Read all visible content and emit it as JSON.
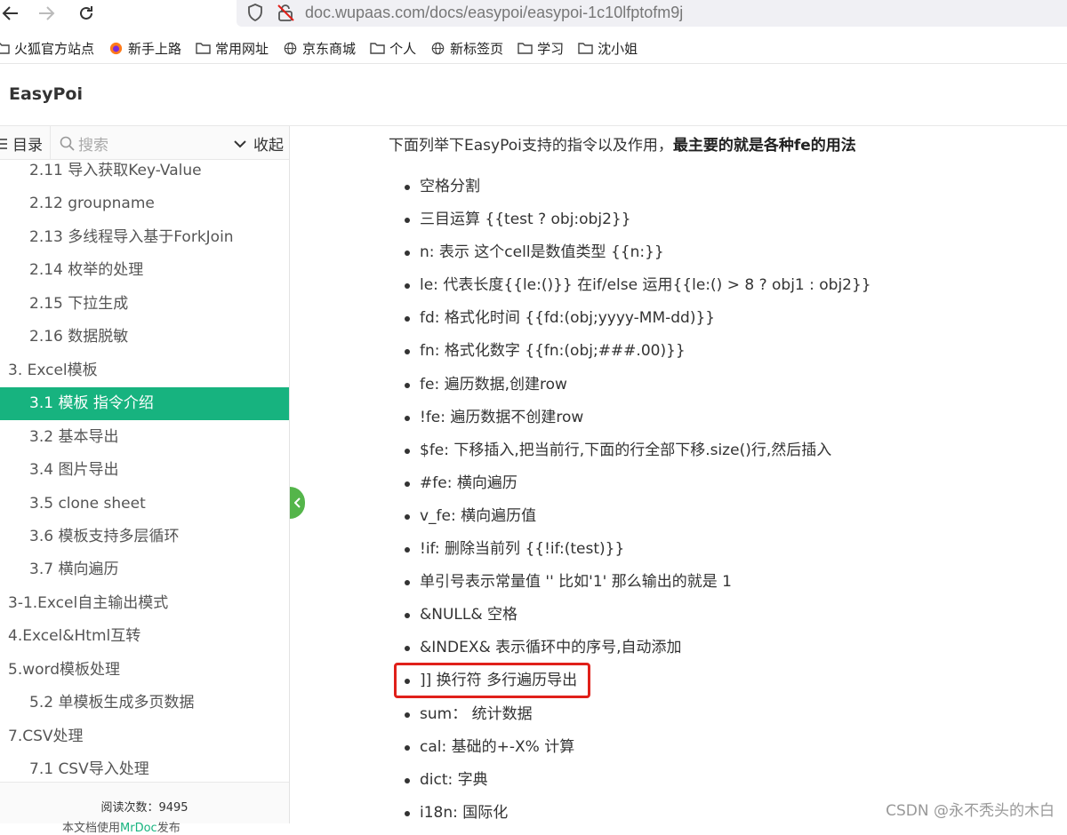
{
  "browser": {
    "url": "doc.wupaas.com/docs/easypoi/easypoi-1c10lfptofm9j",
    "bookmarks": [
      {
        "label": "火狐官方站点",
        "icon": "folder-icon"
      },
      {
        "label": "新手上路",
        "icon": "firefox-icon"
      },
      {
        "label": "常用网址",
        "icon": "folder-icon"
      },
      {
        "label": "京东商城",
        "icon": "globe-icon"
      },
      {
        "label": "个人",
        "icon": "folder-icon"
      },
      {
        "label": "新标签页",
        "icon": "globe-icon"
      },
      {
        "label": "学习",
        "icon": "folder-icon"
      },
      {
        "label": "沈小姐",
        "icon": "folder-icon"
      }
    ]
  },
  "site": {
    "title": "EasyPoi"
  },
  "sidebar": {
    "toc_label": "目录",
    "search_placeholder": "搜索",
    "collapse_label": "收起",
    "items": [
      {
        "label": "2.11 导入获取Key-Value",
        "level": 2,
        "active": false
      },
      {
        "label": "2.12 groupname",
        "level": 2,
        "active": false
      },
      {
        "label": "2.13 多线程导入基于ForkJoin",
        "level": 2,
        "active": false
      },
      {
        "label": "2.14 枚举的处理",
        "level": 2,
        "active": false
      },
      {
        "label": "2.15 下拉生成",
        "level": 2,
        "active": false
      },
      {
        "label": "2.16 数据脱敏",
        "level": 2,
        "active": false
      },
      {
        "label": "3. Excel模板",
        "level": 1,
        "active": false
      },
      {
        "label": "3.1 模板 指令介绍",
        "level": 2,
        "active": true
      },
      {
        "label": "3.2 基本导出",
        "level": 2,
        "active": false
      },
      {
        "label": "3.4 图片导出",
        "level": 2,
        "active": false
      },
      {
        "label": "3.5 clone sheet",
        "level": 2,
        "active": false
      },
      {
        "label": "3.6 模板支持多层循环",
        "level": 2,
        "active": false
      },
      {
        "label": "3.7 横向遍历",
        "level": 2,
        "active": false
      },
      {
        "label": "3-1.Excel自主输出模式",
        "level": 1,
        "active": false
      },
      {
        "label": "4.Excel&Html互转",
        "level": 1,
        "active": false
      },
      {
        "label": "5.word模板处理",
        "level": 1,
        "active": false
      },
      {
        "label": "5.2 单模板生成多页数据",
        "level": 2,
        "active": false
      },
      {
        "label": "7.CSV处理",
        "level": 1,
        "active": false
      },
      {
        "label": "7.1 CSV导入处理",
        "level": 2,
        "active": false
      }
    ],
    "footer": {
      "views_label": "阅读次数：9495",
      "cut_prefix": "本文档使用",
      "cut_link": "MrDoc",
      "cut_suffix": "发布"
    }
  },
  "content": {
    "intro_prefix": "下面列举下EasyPoi支持的指令以及作用，",
    "intro_bold": "最主要的就是各种fe的用法",
    "directives": [
      "空格分割",
      "三目运算 {{test ? obj:obj2}}",
      "n: 表示 这个cell是数值类型 {{n:}}",
      "le: 代表长度{{le:()}} 在if/else 运用{{le:() > 8 ? obj1 : obj2}}",
      "fd: 格式化时间 {{fd:(obj;yyyy-MM-dd)}}",
      "fn: 格式化数字 {{fn:(obj;###.00)}}",
      "fe: 遍历数据,创建row",
      "!fe: 遍历数据不创建row",
      "$fe: 下移插入,把当前行,下面的行全部下移.size()行,然后插入",
      "#fe: 横向遍历",
      "v_fe: 横向遍历值",
      "!if: 删除当前列 {{!if:(test)}}",
      "单引号表示常量值 '' 比如'1' 那么输出的就是 1",
      "&NULL& 空格",
      "&INDEX& 表示循环中的序号,自动添加",
      "]] 换行符 多行遍历导出",
      "sum： 统计数据",
      "cal: 基础的+-X% 计算",
      "dict: 字典",
      "i18n: 国际化"
    ]
  },
  "watermark": "CSDN @永不秃头的木白",
  "colors": {
    "accent": "#17b37f",
    "handle": "#54b54a",
    "highlight": "#e0201a"
  }
}
